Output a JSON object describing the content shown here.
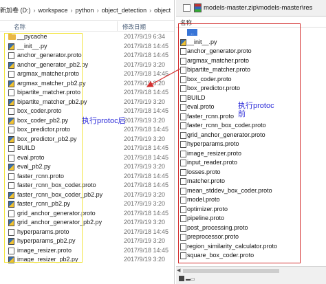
{
  "explorer": {
    "breadcrumb": [
      "新加卷 (D:)",
      "workspace",
      "python",
      "object_detection",
      "object"
    ],
    "columns": {
      "name": "名称",
      "date": "修改日期"
    },
    "files": [
      {
        "name": "__pycache",
        "date": "2017/9/19 6:34",
        "icon": "folder-icon"
      },
      {
        "name": "__init__.py",
        "date": "2017/9/18 14:45",
        "icon": "python-file-icon"
      },
      {
        "name": "anchor_generator.proto",
        "date": "2017/9/18 14:45",
        "icon": "file-icon"
      },
      {
        "name": "anchor_generator_pb2.py",
        "date": "2017/9/19 3:20",
        "icon": "python-file-icon"
      },
      {
        "name": "argmax_matcher.proto",
        "date": "2017/9/18 14:45",
        "icon": "file-icon"
      },
      {
        "name": "argmax_matcher_pb2.py",
        "date": "2017/9/19 3:20",
        "icon": "python-file-icon"
      },
      {
        "name": "bipartite_matcher.proto",
        "date": "2017/9/18 14:45",
        "icon": "file-icon"
      },
      {
        "name": "bipartite_matcher_pb2.py",
        "date": "2017/9/19 3:20",
        "icon": "python-file-icon"
      },
      {
        "name": "box_coder.proto",
        "date": "2017/9/18 14:45",
        "icon": "file-icon"
      },
      {
        "name": "box_coder_pb2.py",
        "date": "2017/9/19 3:20",
        "icon": "python-file-icon"
      },
      {
        "name": "box_predictor.proto",
        "date": "2017/9/18 14:45",
        "icon": "file-icon"
      },
      {
        "name": "box_predictor_pb2.py",
        "date": "2017/9/19 3:20",
        "icon": "python-file-icon"
      },
      {
        "name": "BUILD",
        "date": "2017/9/18 14:45",
        "icon": "file-icon"
      },
      {
        "name": "eval.proto",
        "date": "2017/9/18 14:45",
        "icon": "file-icon"
      },
      {
        "name": "eval_pb2.py",
        "date": "2017/9/19 3:20",
        "icon": "python-file-icon"
      },
      {
        "name": "faster_rcnn.proto",
        "date": "2017/9/18 14:45",
        "icon": "file-icon"
      },
      {
        "name": "faster_rcnn_box_coder.proto",
        "date": "2017/9/18 14:45",
        "icon": "file-icon"
      },
      {
        "name": "faster_rcnn_box_coder_pb2.py",
        "date": "2017/9/19 3:20",
        "icon": "python-file-icon"
      },
      {
        "name": "faster_rcnn_pb2.py",
        "date": "2017/9/19 3:20",
        "icon": "python-file-icon"
      },
      {
        "name": "grid_anchor_generator.proto",
        "date": "2017/9/18 14:45",
        "icon": "file-icon"
      },
      {
        "name": "grid_anchor_generator_pb2.py",
        "date": "2017/9/19 3:20",
        "icon": "python-file-icon"
      },
      {
        "name": "hyperparams.proto",
        "date": "2017/9/18 14:45",
        "icon": "file-icon"
      },
      {
        "name": "hyperparams_pb2.py",
        "date": "2017/9/19 3:20",
        "icon": "python-file-icon"
      },
      {
        "name": "image_resizer.proto",
        "date": "2017/9/18 14:45",
        "icon": "file-icon"
      },
      {
        "name": "image_resizer_pb2.py",
        "date": "2017/9/19 3:20",
        "icon": "python-file-icon"
      }
    ]
  },
  "archive": {
    "title": "models-master.zip\\models-master\\res",
    "column": "名称",
    "files": [
      {
        "name": "..",
        "icon": "up-folder-icon",
        "selected": true
      },
      {
        "name": "__init__.py",
        "icon": "python-file-icon"
      },
      {
        "name": "anchor_generator.proto",
        "icon": "file-icon"
      },
      {
        "name": "argmax_matcher.proto",
        "icon": "file-icon"
      },
      {
        "name": "bipartite_matcher.proto",
        "icon": "file-icon"
      },
      {
        "name": "box_coder.proto",
        "icon": "file-icon"
      },
      {
        "name": "box_predictor.proto",
        "icon": "file-icon"
      },
      {
        "name": "BUILD",
        "icon": "file-icon"
      },
      {
        "name": "eval.proto",
        "icon": "file-icon"
      },
      {
        "name": "faster_rcnn.proto",
        "icon": "file-icon"
      },
      {
        "name": "faster_rcnn_box_coder.proto",
        "icon": "file-icon"
      },
      {
        "name": "grid_anchor_generator.proto",
        "icon": "file-icon"
      },
      {
        "name": "hyperparams.proto",
        "icon": "file-icon"
      },
      {
        "name": "image_resizer.proto",
        "icon": "file-icon"
      },
      {
        "name": "input_reader.proto",
        "icon": "file-icon"
      },
      {
        "name": "losses.proto",
        "icon": "file-icon"
      },
      {
        "name": "matcher.proto",
        "icon": "file-icon"
      },
      {
        "name": "mean_stddev_box_coder.proto",
        "icon": "file-icon"
      },
      {
        "name": "model.proto",
        "icon": "file-icon"
      },
      {
        "name": "optimizer.proto",
        "icon": "file-icon"
      },
      {
        "name": "pipeline.proto",
        "icon": "file-icon"
      },
      {
        "name": "post_processing.proto",
        "icon": "file-icon"
      },
      {
        "name": "preprocessor.proto",
        "icon": "file-icon"
      },
      {
        "name": "region_similarity_calculator.proto",
        "icon": "file-icon"
      },
      {
        "name": "square_box_coder.proto",
        "icon": "file-icon"
      }
    ]
  },
  "annotations": {
    "after": "执行protoc后",
    "before": "执行protoc前"
  },
  "colors": {
    "highlight_left": "#f2e43c",
    "highlight_right": "#d32f2f",
    "annotation_text": "#2b2bd8",
    "selection": "#3875d7"
  }
}
